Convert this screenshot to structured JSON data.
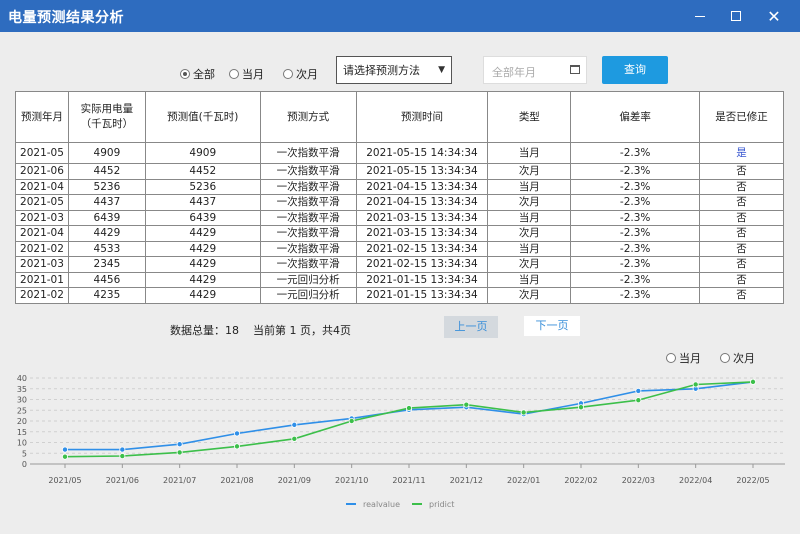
{
  "window": {
    "title": "电量预测结果分析"
  },
  "filter": {
    "radios": [
      {
        "label": "全部",
        "checked": true
      },
      {
        "label": "当月",
        "checked": false
      },
      {
        "label": "次月",
        "checked": false
      }
    ],
    "method_select": "请选择预测方法",
    "date_placeholder": "全部年月",
    "query_label": "查询"
  },
  "table": {
    "headers": [
      "预测年月",
      "实际用电量\n（千瓦时）",
      "预测值(千瓦时)",
      "预测方式",
      "预测时间",
      "类型",
      "偏差率",
      "是否已修正"
    ],
    "rows": [
      [
        "2021-05",
        "4909",
        "4909",
        "一次指数平滑",
        "2021-05-15 14:34:34",
        "当月",
        "-2.3%",
        "是"
      ],
      [
        "2021-06",
        "4452",
        "4452",
        "一次指数平滑",
        "2021-05-15 13:34:34",
        "次月",
        "-2.3%",
        "否"
      ],
      [
        "2021-04",
        "5236",
        "5236",
        "一次指数平滑",
        "2021-04-15 13:34:34",
        "当月",
        "-2.3%",
        "否"
      ],
      [
        "2021-05",
        "4437",
        "4437",
        "一次指数平滑",
        "2021-04-15 13:34:34",
        "次月",
        "-2.3%",
        "否"
      ],
      [
        "2021-03",
        "6439",
        "6439",
        "一次指数平滑",
        "2021-03-15 13:34:34",
        "当月",
        "-2.3%",
        "否"
      ],
      [
        "2021-04",
        "4429",
        "4429",
        "一次指数平滑",
        "2021-03-15 13:34:34",
        "次月",
        "-2.3%",
        "否"
      ],
      [
        "2021-02",
        "4533",
        "4429",
        "一次指数平滑",
        "2021-02-15 13:34:34",
        "当月",
        "-2.3%",
        "否"
      ],
      [
        "2021-03",
        "2345",
        "4429",
        "一次指数平滑",
        "2021-02-15 13:34:34",
        "次月",
        "-2.3%",
        "否"
      ],
      [
        "2021-01",
        "4456",
        "4429",
        "一元回归分析",
        "2021-01-15 13:34:34",
        "当月",
        "-2.3%",
        "否"
      ],
      [
        "2021-02",
        "4235",
        "4429",
        "一元回归分析",
        "2021-01-15 13:34:34",
        "次月",
        "-2.3%",
        "否"
      ]
    ]
  },
  "pager": {
    "info": "数据总量：18    当前第 1 页，共4页",
    "prev_label": "上一页",
    "next_label": "下一页"
  },
  "chart_toggle": [
    {
      "label": "当月",
      "checked": false
    },
    {
      "label": "次月",
      "checked": false
    }
  ],
  "chart_data": {
    "type": "line",
    "categories": [
      "2021/05",
      "2021/06",
      "2021/07",
      "2021/08",
      "2021/09",
      "2021/10",
      "2021/11",
      "2021/12",
      "2022/01",
      "2022/02",
      "2022/03",
      "2022/04",
      "2022/05"
    ],
    "series": [
      {
        "name": "realvalue",
        "color": "#2f8fe8",
        "values": [
          6.7,
          6.7,
          9.2,
          14.2,
          18.2,
          21.2,
          25.2,
          26.4,
          23.2,
          28.2,
          34.0,
          35.0,
          38.2
        ]
      },
      {
        "name": "pridict",
        "color": "#3cbf4a",
        "values": [
          3.4,
          3.7,
          5.4,
          8.2,
          11.7,
          20.0,
          26.0,
          27.6,
          24.0,
          26.4,
          29.7,
          37.0,
          38.2
        ]
      }
    ],
    "yticks": [
      0,
      5,
      10,
      15,
      20,
      25,
      30,
      35,
      40
    ],
    "ylim": [
      0,
      40
    ],
    "grid": true,
    "legend_position": "bottom-center"
  }
}
